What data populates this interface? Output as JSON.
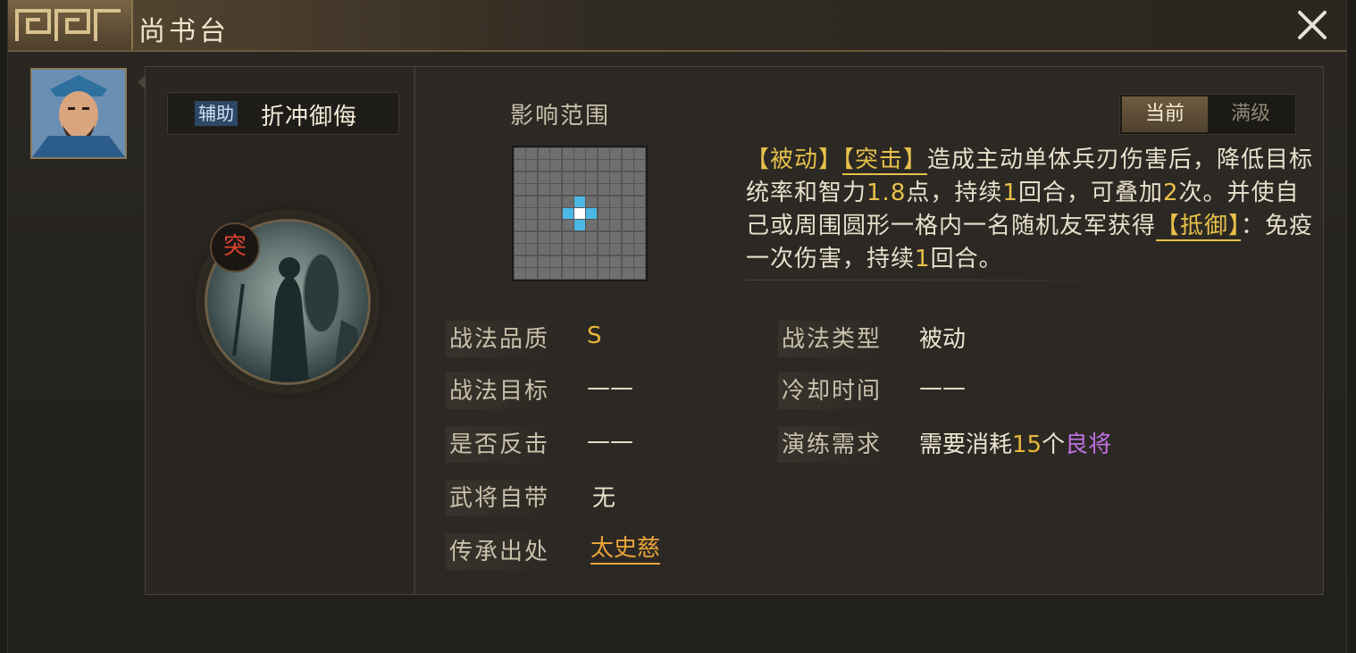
{
  "window": {
    "title": "尚书台"
  },
  "skill": {
    "type": "辅助",
    "name": "折冲御侮",
    "emblem_glyph": "突",
    "range_label": "影响范围",
    "range_grid": {
      "size": 11,
      "center": [
        5,
        5
      ],
      "highlight": [
        [
          4,
          5
        ],
        [
          6,
          5
        ],
        [
          5,
          4
        ],
        [
          5,
          6
        ]
      ]
    }
  },
  "toggle": {
    "current": "当前",
    "max": "满级"
  },
  "description": {
    "t1": "【被动】",
    "k1": "【突击】",
    "s1": "造成主动单体兵刃伤害后，降低目标统率和智力",
    "n1": "1.8",
    "s2": "点，持续",
    "n2": "1",
    "s3": "回合，可叠加",
    "n3": "2",
    "s4": "次。并使自己或周围圆形一格内一名随机友军获得",
    "k2": "【抵御】",
    "s5": "：免疫一次伤害，持续",
    "n4": "1",
    "s6": "回合。"
  },
  "attributes": {
    "quality_label": "战法品质",
    "quality_value": "S",
    "target_label": "战法目标",
    "target_value": "——",
    "counter_label": "是否反击",
    "counter_value": "——",
    "own_label": "武将自带",
    "own_value": "无",
    "inherit_label": "传承出处",
    "inherit_value": "太史慈",
    "skilltype_label": "战法类型",
    "skilltype_value": "被动",
    "cooldown_label": "冷却时间",
    "cooldown_value": "——",
    "train_label": "演练需求",
    "train_prefix": "需要消耗",
    "train_count": "15",
    "train_unit": "个",
    "train_item": "良将"
  },
  "colors": {
    "accent_gold": "#e6c04a",
    "purple": "#c070e0",
    "grid_highlight": "#4bb8e6",
    "grid_center": "#ffffff"
  }
}
